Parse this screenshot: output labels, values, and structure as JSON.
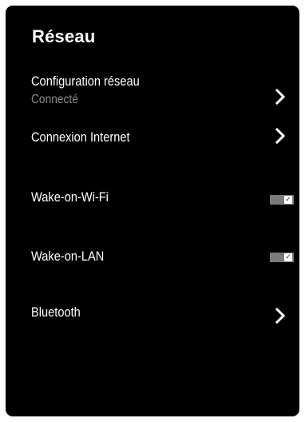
{
  "screen": {
    "title": "Réseau"
  },
  "items": {
    "network_config": {
      "label": "Configuration réseau",
      "status": "Connecté",
      "icon": "chevron-right-icon"
    },
    "internet_connection": {
      "label": "Connexion Internet",
      "icon": "chevron-right-icon"
    },
    "wake_on_wifi": {
      "label": "Wake-on-Wi-Fi",
      "checked": true,
      "check_glyph": "✓"
    },
    "wake_on_lan": {
      "label": "Wake-on-LAN",
      "checked": true,
      "check_glyph": "✓"
    },
    "bluetooth": {
      "label": "Bluetooth",
      "icon": "chevron-right-icon"
    }
  },
  "colors": {
    "background": "#000000",
    "text": "#ffffff",
    "status_text": "#8a8a8a",
    "toggle_track": "#7a7a7a"
  }
}
